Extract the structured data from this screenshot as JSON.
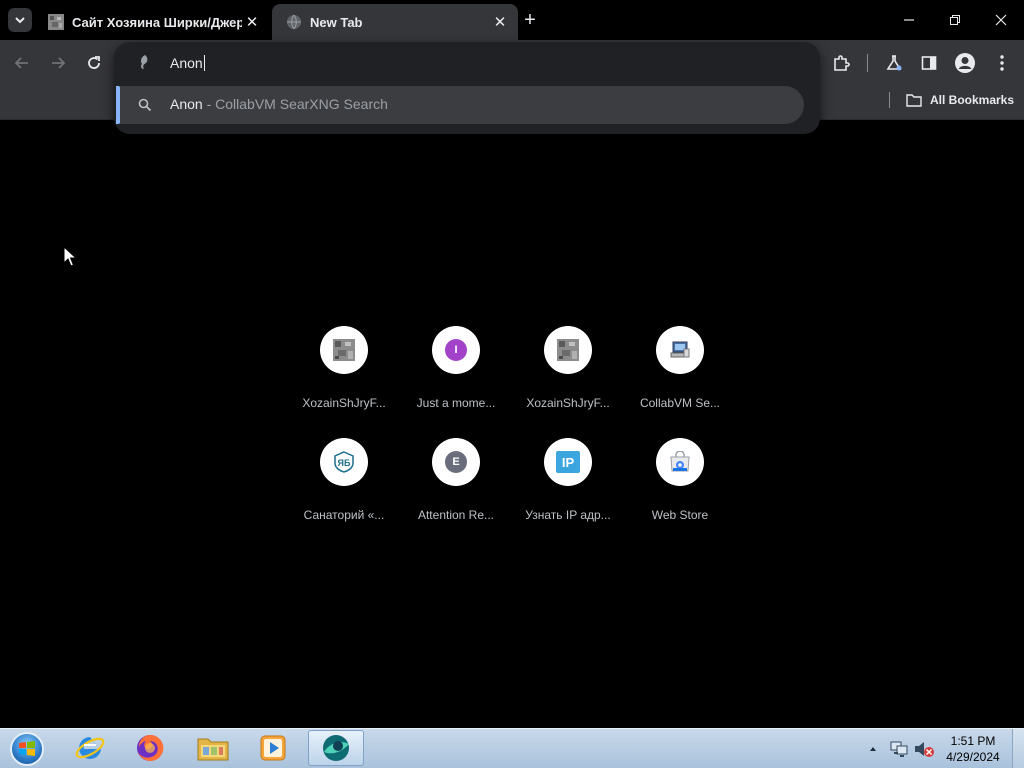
{
  "tabs": [
    {
      "title": "Сайт Хозяина Ширки/Джерико",
      "active": false
    },
    {
      "title": "New Tab",
      "active": true
    }
  ],
  "omnibox": {
    "input_value": "Anon",
    "suggestion_query": "Anon",
    "suggestion_separator": " - ",
    "suggestion_description": "CollabVM SearXNG Search"
  },
  "bookmarks": {
    "all_label": "All Bookmarks"
  },
  "shortcuts": [
    {
      "label": "XozainShJryF...",
      "icon": "pixel-favicon"
    },
    {
      "label": "Just a mome...",
      "icon": "letter-I",
      "letter": "I",
      "color": "#a142c9"
    },
    {
      "label": "XozainShJryF...",
      "icon": "pixel-favicon"
    },
    {
      "label": "CollabVM Se...",
      "icon": "computer-favicon"
    },
    {
      "label": "Санаторий «...",
      "icon": "sanatorium-logo"
    },
    {
      "label": "Attention Re...",
      "icon": "letter-E",
      "letter": "E",
      "color": "#6a6e7c"
    },
    {
      "label": "Узнать IP адр...",
      "icon": "ip-logo",
      "letter": "IP",
      "color": "#3ba5e0"
    },
    {
      "label": "Web Store",
      "icon": "web-store-icon"
    }
  ],
  "taskbar": {
    "apps": [
      "internet-explorer-icon",
      "firefox-icon",
      "file-explorer-icon",
      "media-player-icon",
      "browser-icon"
    ],
    "time": "1:51 PM",
    "date": "4/29/2024"
  }
}
